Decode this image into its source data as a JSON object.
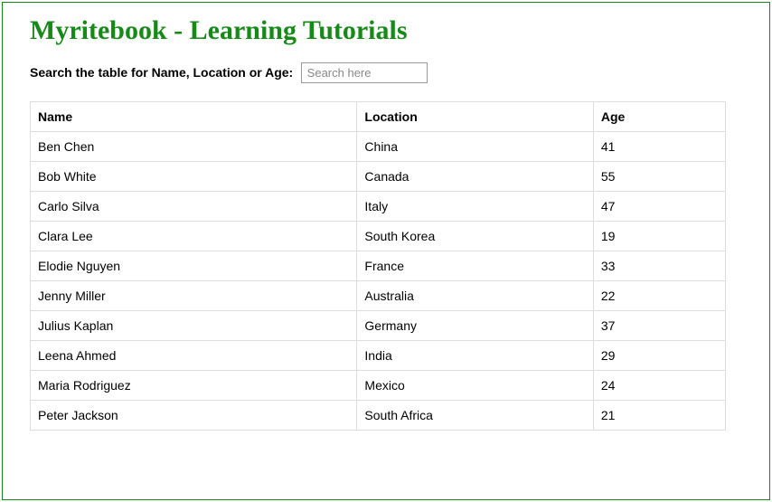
{
  "title": "Myritebook - Learning Tutorials",
  "search": {
    "label": "Search the table for Name, Location or Age:",
    "placeholder": "Search here",
    "value": ""
  },
  "table": {
    "headers": {
      "name": "Name",
      "location": "Location",
      "age": "Age"
    },
    "rows": [
      {
        "name": "Ben Chen",
        "location": "China",
        "age": "41"
      },
      {
        "name": "Bob White",
        "location": "Canada",
        "age": "55"
      },
      {
        "name": "Carlo Silva",
        "location": "Italy",
        "age": "47"
      },
      {
        "name": "Clara Lee",
        "location": "South Korea",
        "age": "19"
      },
      {
        "name": "Elodie Nguyen",
        "location": "France",
        "age": "33"
      },
      {
        "name": "Jenny Miller",
        "location": "Australia",
        "age": "22"
      },
      {
        "name": "Julius Kaplan",
        "location": "Germany",
        "age": "37"
      },
      {
        "name": "Leena Ahmed",
        "location": "India",
        "age": "29"
      },
      {
        "name": "Maria Rodriguez",
        "location": "Mexico",
        "age": "24"
      },
      {
        "name": "Peter Jackson",
        "location": "South Africa",
        "age": "21"
      }
    ]
  }
}
